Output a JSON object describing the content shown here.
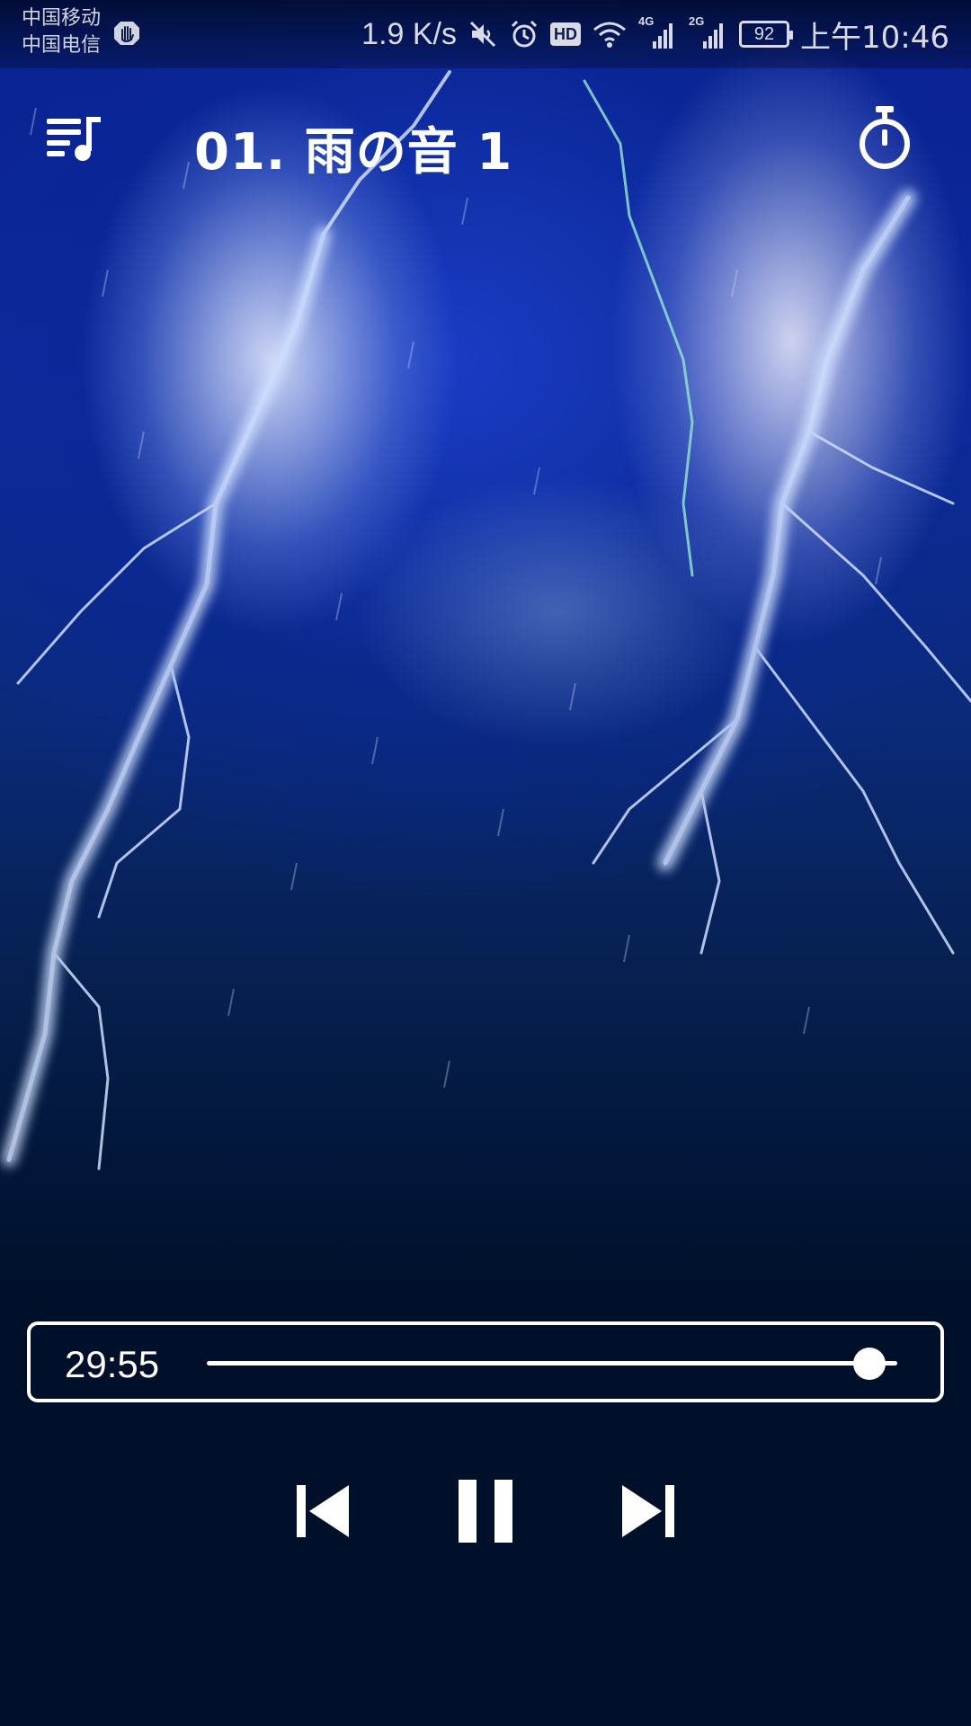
{
  "status_bar": {
    "carrier_1": "中国移动",
    "carrier_2": "中国电信",
    "network_speed": "1.9 K/s",
    "hd_label": "HD",
    "signal_1_label": "4G",
    "signal_2_label": "2G",
    "battery_level": "92",
    "time": "上午10:46",
    "icons": [
      "hand-icon",
      "mute-icon",
      "alarm-icon",
      "hd-icon",
      "wifi-icon",
      "signal-4g-icon",
      "signal-2g-icon",
      "battery-icon"
    ]
  },
  "toolbar": {
    "playlist_icon": "playlist-icon",
    "title": "01. 雨の音 1",
    "timer_icon": "stopwatch-icon"
  },
  "artwork": {
    "subject": "lightning-storm"
  },
  "player": {
    "elapsed": "29:55",
    "progress_fraction": 0.96
  },
  "controls": {
    "previous_icon": "skip-previous-icon",
    "pause_icon": "pause-icon",
    "next_icon": "skip-next-icon"
  },
  "colors": {
    "background": "#00102b",
    "accent": "#ffffff",
    "sky_blue": "#1a3cc4"
  }
}
